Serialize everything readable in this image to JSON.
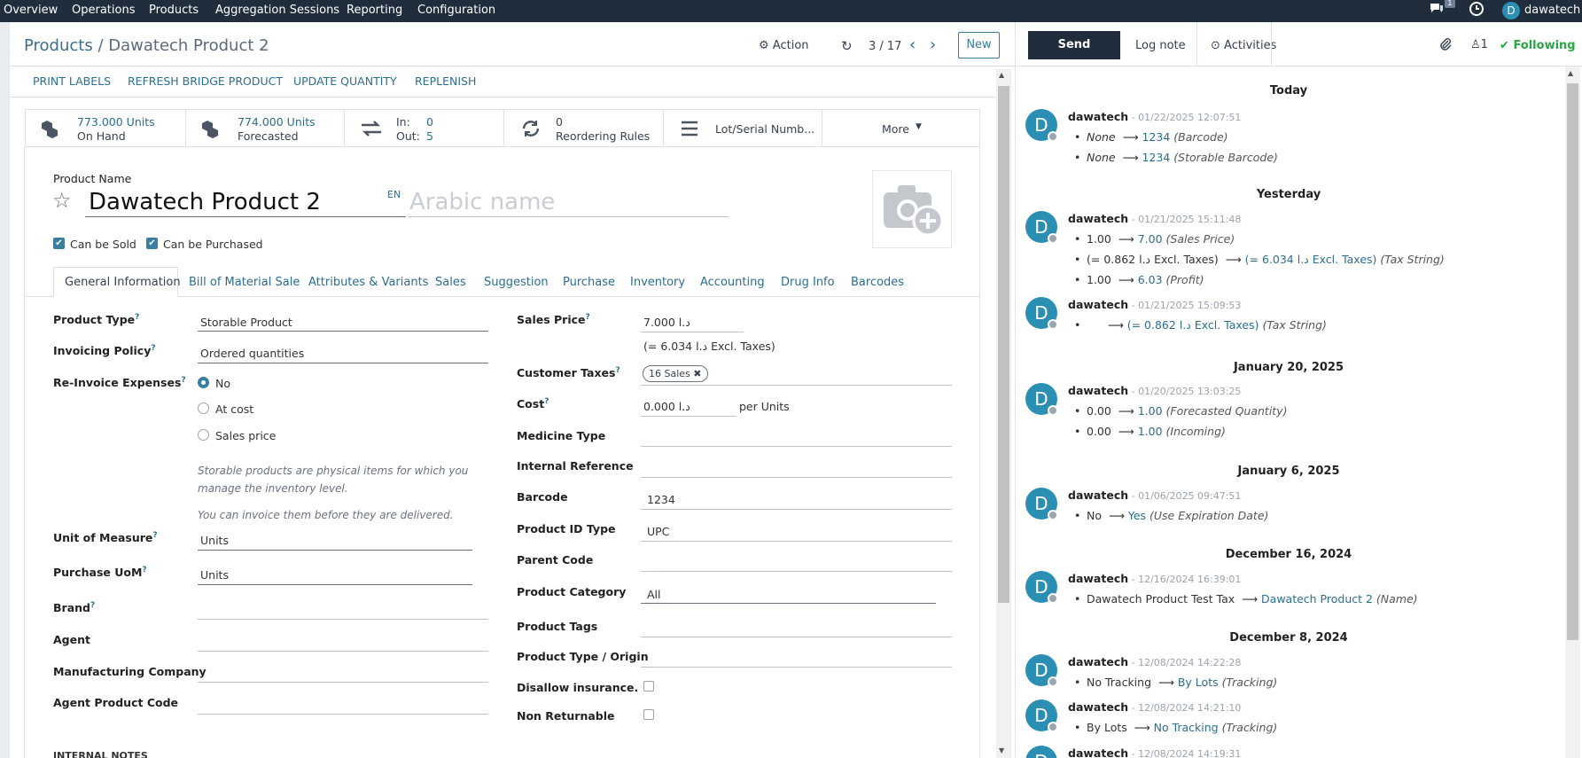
{
  "navbar": {
    "menus": [
      "Overview",
      "Operations",
      "Products",
      "Aggregation Sessions",
      "Reporting",
      "Configuration"
    ],
    "messages_count": "1",
    "user_initial": "D",
    "user_name": "dawatech"
  },
  "control_panel": {
    "breadcrumb_parent": "Products",
    "breadcrumb_sep": " / ",
    "breadcrumb_current": "Dawatech Product 2",
    "action_label": "Action",
    "pager": "3 / 17",
    "new_label": "New"
  },
  "header_buttons": [
    "PRINT LABELS",
    "REFRESH BRIDGE PRODUCT",
    "UPDATE QUANTITY",
    "REPLENISH"
  ],
  "stat_buttons": {
    "on_hand_value": "773.000 Units",
    "on_hand_label": "On Hand",
    "forecasted_value": "774.000 Units",
    "forecasted_label": "Forecasted",
    "in_label": "In:",
    "in_value": "0",
    "out_label": "Out:",
    "out_value": "5",
    "reordering_value": "0",
    "reordering_label": "Reordering Rules",
    "lot_label": "Lot/Serial Numb...",
    "more_label": "More"
  },
  "product": {
    "name_label": "Product Name",
    "name": "Dawatech Product 2",
    "lang": "EN",
    "arabic_placeholder": "Arabic name",
    "can_be_sold": "Can be Sold",
    "can_be_purchased": "Can be Purchased"
  },
  "tabs": [
    "General Information",
    "Bill of Material Sale",
    "Attributes & Variants",
    "Sales",
    "Suggestion",
    "Purchase",
    "Inventory",
    "Accounting",
    "Drug Info",
    "Barcodes"
  ],
  "left_fields": {
    "product_type_label": "Product Type",
    "product_type": "Storable Product",
    "invoicing_policy_label": "Invoicing Policy",
    "invoicing_policy": "Ordered quantities",
    "reinvoice_label": "Re-Invoice Expenses",
    "reinvoice_options": [
      "No",
      "At cost",
      "Sales price"
    ],
    "note_1": "Storable products are physical items for which you",
    "note_2": "manage the inventory level.",
    "note_3": "You can invoice them before they are delivered.",
    "uom_label": "Unit of Measure",
    "uom": "Units",
    "purchase_uom_label": "Purchase UoM",
    "purchase_uom": "Units",
    "brand_label": "Brand",
    "agent_label": "Agent",
    "manufacturing_label": "Manufacturing Company",
    "agent_code_label": "Agent Product Code",
    "internal_notes": "INTERNAL NOTES"
  },
  "right_fields": {
    "sales_price_label": "Sales Price",
    "sales_price": "د.ا 7.000",
    "sales_price_excl": "(= 6.034  د.ا  Excl. Taxes)",
    "customer_taxes_label": "Customer Taxes",
    "customer_tax_tag": "16 Sales",
    "cost_label": "Cost",
    "cost": "د.ا 0.000",
    "cost_unit": "per Units",
    "medicine_type_label": "Medicine Type",
    "internal_reference_label": "Internal Reference",
    "barcode_label": "Barcode",
    "barcode": "1234",
    "product_id_type_label": "Product ID Type",
    "product_id_type": "UPC",
    "parent_code_label": "Parent Code",
    "product_category_label": "Product Category",
    "product_category": "All",
    "product_tags_label": "Product Tags",
    "product_type_origin_label": "Product Type / Origin",
    "disallow_insurance_label": "Disallow insurance.",
    "non_returnable_label": "Non Returnable"
  },
  "chatter": {
    "send_message": "Send message",
    "log_note": "Log note",
    "activities": "Activities",
    "followers_count": "1",
    "following": "Following",
    "groups": [
      {
        "date": "Today"
      },
      {
        "date": "Yesterday"
      },
      {
        "date": "January 20, 2025"
      },
      {
        "date": "January 6, 2025"
      },
      {
        "date": "December 16, 2024"
      },
      {
        "date": "December 8, 2024"
      }
    ],
    "messages": [
      {
        "author": "dawatech",
        "ts": "- 01/22/2025 12:07:51",
        "lines": [
          {
            "old": "None",
            "new": "1234",
            "field": "(Barcode)"
          },
          {
            "old": "None",
            "new": "1234",
            "field": "(Storable Barcode)"
          }
        ]
      },
      {
        "author": "dawatech",
        "ts": "- 01/21/2025 15:11:48",
        "lines": [
          {
            "old": "1.00",
            "new": "7.00",
            "field": "(Sales Price)"
          },
          {
            "old": "(= 0.862  د.ا  Excl. Taxes)",
            "new": "(= 6.034  د.ا  Excl. Taxes)",
            "field": "(Tax String)"
          },
          {
            "old": "1.00",
            "new": "6.03",
            "field": "(Profit)"
          }
        ]
      },
      {
        "author": "dawatech",
        "ts": "- 01/21/2025 15:09:53",
        "lines": [
          {
            "old": "",
            "new": "(= 0.862  د.ا  Excl. Taxes)",
            "field": "(Tax String)"
          }
        ]
      },
      {
        "author": "dawatech",
        "ts": "- 01/20/2025 13:03:25",
        "lines": [
          {
            "old": "0.00",
            "new": "1.00",
            "field": "(Forecasted Quantity)"
          },
          {
            "old": "0.00",
            "new": "1.00",
            "field": "(Incoming)"
          }
        ]
      },
      {
        "author": "dawatech",
        "ts": "- 01/06/2025 09:47:51",
        "lines": [
          {
            "old": "No",
            "new": "Yes",
            "field": "(Use Expiration Date)"
          }
        ]
      },
      {
        "author": "dawatech",
        "ts": "- 12/16/2024 16:39:01",
        "lines": [
          {
            "old": "Dawatech Product Test Tax",
            "new": "Dawatech Product 2",
            "field": "(Name)"
          }
        ]
      },
      {
        "author": "dawatech",
        "ts": "- 12/08/2024 14:22:28",
        "lines": [
          {
            "old": "No Tracking",
            "new": "By Lots",
            "field": "(Tracking)"
          }
        ]
      },
      {
        "author": "dawatech",
        "ts": "- 12/08/2024 14:21:10",
        "lines": [
          {
            "old": "By Lots",
            "new": "No Tracking",
            "field": "(Tracking)"
          }
        ]
      },
      {
        "author": "dawatech",
        "ts": "- 12/08/2024 14:19:31",
        "lines": []
      }
    ]
  },
  "colors": {
    "navbar": "#1f2d3d",
    "link": "#2c6e8f",
    "avatar": "#2b8fb4",
    "following": "#28a745"
  }
}
